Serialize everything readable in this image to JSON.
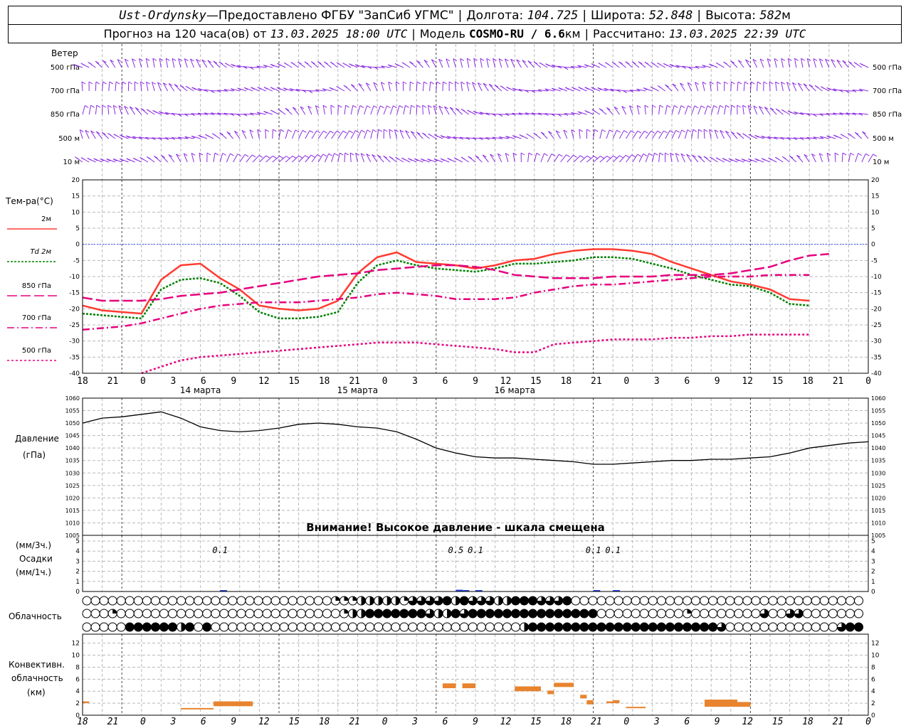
{
  "header": {
    "station": "Ust-Ordynsky",
    "dash": " — ",
    "provider": "Предоставлено ФГБУ \"ЗапСиб УГМС\"",
    "lon_label": "Долгота:",
    "lon": "104.725",
    "lat_label": "Широта:",
    "lat": "52.848",
    "alt_label": "Высота:",
    "alt": "582",
    "alt_unit": "м",
    "forecast_label": "Прогноз на 120 часа(ов) от",
    "forecast_from": "13.03.2025 18:00 UTC",
    "model_label": "Модель",
    "model": "COSMO-RU / 6.6",
    "model_unit": "км",
    "calc_label": "Рассчитано:",
    "calc_time": "13.03.2025 22:39 UTC"
  },
  "wind": {
    "title": "Ветер",
    "levels": [
      "500 гПа",
      "700 гПа",
      "850 гПа",
      "500 м",
      "10 м"
    ],
    "color": "#8a2be2"
  },
  "temperature": {
    "title": "Тем-ра(°С)",
    "legend": [
      {
        "label": "2м",
        "color": "#ff3b30",
        "dash": ""
      },
      {
        "label": "Td  2м",
        "color": "#008000",
        "dash": "3,2"
      },
      {
        "label": "850 гПа",
        "color": "#e6007e",
        "dash": "14,5"
      },
      {
        "label": "700 гПа",
        "color": "#e6007e",
        "dash": "10,4,2,4"
      },
      {
        "label": "500 гПа",
        "color": "#e6007e",
        "dash": "3,3"
      }
    ],
    "yticks": [
      20,
      15,
      10,
      5,
      0,
      -5,
      -10,
      -15,
      -20,
      -25,
      -30,
      -35,
      -40
    ]
  },
  "pressure": {
    "title": "Давление",
    "unit": "(гПа)",
    "yticks": [
      1060,
      1055,
      1050,
      1045,
      1040,
      1035,
      1030,
      1025,
      1020,
      1015,
      1010,
      1005
    ],
    "warning": "Внимание! Высокое давление - шкала смещена"
  },
  "precip": {
    "title": "Осадки",
    "unit3": "(мм/3ч.)",
    "unit1": "(мм/1ч.)",
    "yticks": [
      5,
      4,
      3,
      2,
      1,
      0
    ],
    "labels": [
      {
        "h": 21,
        "text": "0.1"
      },
      {
        "h": 57,
        "text": "0.5"
      },
      {
        "h": 60,
        "text": "0.1"
      },
      {
        "h": 78,
        "text": "0.1"
      },
      {
        "h": 81,
        "text": "0.1"
      }
    ]
  },
  "clouds": {
    "title": "Облачность"
  },
  "convective": {
    "title1": "Конвективн.",
    "title2": "облачность",
    "unit": "(км)",
    "yticks": [
      12,
      10,
      8,
      6,
      4,
      2,
      0
    ]
  },
  "time_axis": {
    "ticks": [
      "18",
      "21",
      "0",
      "3",
      "6",
      "9",
      "12",
      "15",
      "18",
      "21",
      "0",
      "3",
      "6",
      "9",
      "12",
      "15",
      "18",
      "21",
      "0",
      "3",
      "6",
      "9",
      "12",
      "15",
      "18",
      "21",
      "0"
    ],
    "dates": [
      "14 марта",
      "15 марта",
      "16 марта"
    ]
  },
  "chart_data": {
    "type": "line",
    "x_unit": "hours from 13.03.2025 18:00 UTC",
    "temperature": {
      "x": [
        0,
        3,
        6,
        9,
        12,
        15,
        18,
        21,
        24,
        27,
        30,
        33,
        36,
        39,
        42,
        45,
        48,
        51,
        54,
        57,
        60,
        63,
        66,
        69,
        72,
        75,
        78,
        81,
        84,
        87,
        90,
        93,
        96,
        99,
        102,
        105,
        108,
        111,
        114,
        117,
        120
      ],
      "series": [
        {
          "name": "2м",
          "values": [
            -19,
            -20.5,
            -21,
            -21.5,
            -11,
            -6.5,
            -6,
            -10.5,
            -14,
            -19,
            -20,
            -20.5,
            -20,
            -17.5,
            -9,
            -4,
            -2.5,
            -5.5,
            -6,
            -6.5,
            -7.5,
            -6.5,
            -5,
            -4.5,
            -3,
            -2,
            -1.5,
            -1.5,
            -2,
            -3,
            -5.5,
            -7.5,
            -9.5,
            -11.5,
            -12.5,
            -14,
            -17,
            -17.5
          ]
        },
        {
          "name": "Td 2м",
          "values": [
            -21.5,
            -22,
            -22.5,
            -23,
            -14,
            -11,
            -10.5,
            -12,
            -16,
            -21,
            -23,
            -23,
            -22.5,
            -21,
            -12,
            -6.5,
            -5,
            -6.5,
            -7.5,
            -8,
            -8.5,
            -7.5,
            -6,
            -6,
            -5.5,
            -5,
            -4,
            -4,
            -4.5,
            -6,
            -7.5,
            -9.5,
            -11,
            -12.5,
            -13,
            -15,
            -18.5,
            -19
          ]
        },
        {
          "name": "850 гПа",
          "values": [
            -16.5,
            -17.5,
            -17.5,
            -17.5,
            -17,
            -16,
            -15.5,
            -15,
            -14,
            -13,
            -12,
            -11,
            -10,
            -9.5,
            -9,
            -8,
            -7.5,
            -7,
            -6.5,
            -6.5,
            -7,
            -8,
            -9.5,
            -10,
            -10.5,
            -10.5,
            -10.5,
            -10,
            -10,
            -10,
            -9.5,
            -9.5,
            -9.5,
            -9,
            -8,
            -7,
            -5,
            -3.5,
            -3
          ]
        },
        {
          "name": "700 гПа",
          "values": [
            -26.5,
            -26,
            -25.5,
            -24.5,
            -23,
            -21.5,
            -20,
            -19,
            -18.5,
            -18,
            -18,
            -18,
            -17.5,
            -17,
            -16.5,
            -15.5,
            -15,
            -15.5,
            -16,
            -17,
            -17,
            -17,
            -16.5,
            -15,
            -14,
            -13,
            -12.5,
            -12.5,
            -12,
            -11.5,
            -11,
            -10.5,
            -10,
            -10,
            -10,
            -9.5,
            -9.5,
            -9.5
          ]
        },
        {
          "name": "500 гПа",
          "values": [
            null,
            null,
            null,
            -40,
            -38,
            -36,
            -35,
            -34.5,
            -34,
            -33.5,
            -33,
            -32.5,
            -32,
            -31.5,
            -31,
            -30.5,
            -30.5,
            -30.5,
            -31,
            -31.5,
            -32,
            -32.5,
            -33.5,
            -33.5,
            -31,
            -30.5,
            -30,
            -29.5,
            -29.5,
            -29.5,
            -29,
            -29,
            -28.5,
            -28.5,
            -28,
            -28,
            -28,
            -28
          ]
        }
      ]
    },
    "pressure": {
      "x": [
        0,
        3,
        6,
        9,
        12,
        15,
        18,
        21,
        24,
        27,
        30,
        33,
        36,
        39,
        42,
        45,
        48,
        51,
        54,
        57,
        60,
        63,
        66,
        69,
        72,
        75,
        78,
        81,
        84,
        87,
        90,
        93,
        96,
        99,
        102,
        105,
        108,
        111,
        114,
        117,
        120
      ],
      "values": [
        1050,
        1052,
        1052.5,
        1053.5,
        1054.5,
        1052,
        1048.5,
        1047,
        1046.5,
        1047,
        1048,
        1049.5,
        1050,
        1049.5,
        1048.5,
        1048,
        1046.5,
        1043.5,
        1040,
        1038,
        1036.5,
        1036,
        1036,
        1035.5,
        1035,
        1034.5,
        1033.5,
        1033.5,
        1034,
        1034.5,
        1035,
        1035,
        1035.5,
        1035.5,
        1036,
        1036.5,
        1038,
        1040,
        1041,
        1042,
        1042.5,
        1044
      ]
    },
    "precipitation": {
      "x": [
        21,
        57,
        58,
        60,
        78,
        81
      ],
      "values": [
        0.1,
        0.5,
        0.3,
        0.1,
        0.1,
        0.1
      ]
    },
    "convective_cloud_bars_km": [
      {
        "x0": 0,
        "x1": 1,
        "bottom": 2,
        "top": 2.3
      },
      {
        "x0": 15,
        "x1": 20,
        "bottom": 1,
        "top": 1.2
      },
      {
        "x0": 20,
        "x1": 26,
        "bottom": 1.5,
        "top": 2.3
      },
      {
        "x0": 55,
        "x1": 57,
        "bottom": 4.5,
        "top": 5.3
      },
      {
        "x0": 58,
        "x1": 60,
        "bottom": 4.5,
        "top": 5.3
      },
      {
        "x0": 66,
        "x1": 70,
        "bottom": 4,
        "top": 4.8
      },
      {
        "x0": 71,
        "x1": 72,
        "bottom": 3.5,
        "top": 4.1
      },
      {
        "x0": 72,
        "x1": 75,
        "bottom": 4.7,
        "top": 5.4
      },
      {
        "x0": 76,
        "x1": 77,
        "bottom": 2.8,
        "top": 3.4
      },
      {
        "x0": 77,
        "x1": 78,
        "bottom": 1.8,
        "top": 2.5
      },
      {
        "x0": 80,
        "x1": 81,
        "bottom": 2,
        "top": 2.3
      },
      {
        "x0": 81,
        "x1": 82,
        "bottom": 2,
        "top": 2.5
      },
      {
        "x0": 83,
        "x1": 86,
        "bottom": 1.2,
        "top": 1.4
      },
      {
        "x0": 95,
        "x1": 100,
        "bottom": 1.4,
        "top": 2.6
      },
      {
        "x0": 100,
        "x1": 102,
        "bottom": 1.4,
        "top": 2.2
      }
    ],
    "cloud_cover_rows": [
      "0000000000000000000000000000011122222133334243332244433340000000000000000000000000000000000",
      "0001000000000000000000000000001224444444322434444444444444440000000000100000000300330000000",
      "0000044444424040000000000000000000000000000000000002444444444444444444444430000000000000344"
    ]
  }
}
